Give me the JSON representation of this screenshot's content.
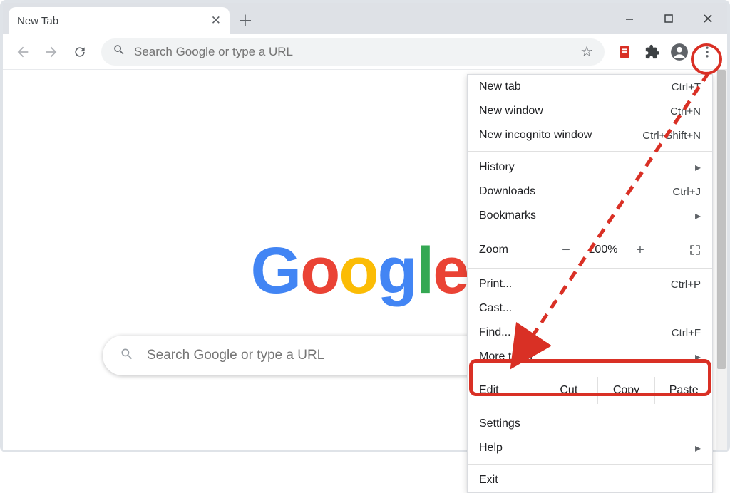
{
  "tab": {
    "title": "New Tab"
  },
  "omnibox": {
    "placeholder": "Search Google or type a URL"
  },
  "ntp_search": {
    "placeholder": "Search Google or type a URL"
  },
  "logo_letters": [
    "G",
    "o",
    "o",
    "g",
    "l",
    "e"
  ],
  "menu": {
    "new_tab": {
      "label": "New tab",
      "shortcut": "Ctrl+T"
    },
    "new_window": {
      "label": "New window",
      "shortcut": "Ctrl+N"
    },
    "incognito": {
      "label": "New incognito window",
      "shortcut": "Ctrl+Shift+N"
    },
    "history": {
      "label": "History"
    },
    "downloads": {
      "label": "Downloads",
      "shortcut": "Ctrl+J"
    },
    "bookmarks": {
      "label": "Bookmarks"
    },
    "zoom": {
      "label": "Zoom",
      "level": "100%"
    },
    "print": {
      "label": "Print...",
      "shortcut": "Ctrl+P"
    },
    "cast": {
      "label": "Cast..."
    },
    "find": {
      "label": "Find...",
      "shortcut": "Ctrl+F"
    },
    "more_tools": {
      "label": "More tools"
    },
    "edit": {
      "label": "Edit",
      "cut": "Cut",
      "copy": "Copy",
      "paste": "Paste"
    },
    "settings": {
      "label": "Settings"
    },
    "help": {
      "label": "Help"
    },
    "exit": {
      "label": "Exit"
    }
  }
}
